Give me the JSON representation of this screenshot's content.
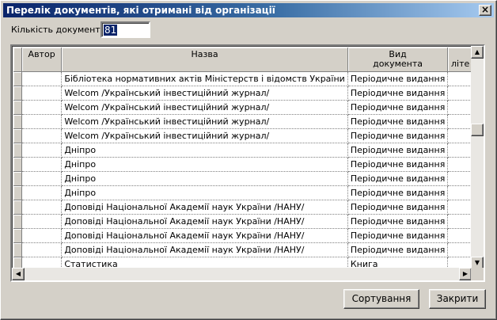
{
  "window": {
    "title": "Перелік документів, які отримані від організації",
    "close_glyph": "×"
  },
  "count": {
    "label": "Кількість документів:",
    "value": "81"
  },
  "grid": {
    "columns": [
      {
        "key": "indicator",
        "label": ""
      },
      {
        "key": "author",
        "label": "Автор"
      },
      {
        "key": "title",
        "label": "Назва"
      },
      {
        "key": "doc_type",
        "label": "Вид\nдокумента"
      },
      {
        "key": "literature",
        "label": "літе"
      }
    ],
    "rows": [
      {
        "author": "",
        "title": "Бібліотека нормативних актів Міністерств і відомств України",
        "doc_type": "Періодичне видання",
        "literature": ""
      },
      {
        "author": "",
        "title": "Welcom /Український інвестиційний журнал/",
        "doc_type": "Періодичне видання",
        "literature": ""
      },
      {
        "author": "",
        "title": "Welcom /Український інвестиційний журнал/",
        "doc_type": "Періодичне видання",
        "literature": ""
      },
      {
        "author": "",
        "title": "Welcom /Український інвестиційний журнал/",
        "doc_type": "Періодичне видання",
        "literature": ""
      },
      {
        "author": "",
        "title": "Welcom /Український інвестиційний журнал/",
        "doc_type": "Періодичне видання",
        "literature": ""
      },
      {
        "author": "",
        "title": "Дніпро",
        "doc_type": "Періодичне видання",
        "literature": ""
      },
      {
        "author": "",
        "title": "Дніпро",
        "doc_type": "Періодичне видання",
        "literature": ""
      },
      {
        "author": "",
        "title": "Дніпро",
        "doc_type": "Періодичне видання",
        "literature": ""
      },
      {
        "author": "",
        "title": "Дніпро",
        "doc_type": "Періодичне видання",
        "literature": ""
      },
      {
        "author": "",
        "title": "Доповіді Національної Академії наук України /НАНУ/",
        "doc_type": "Періодичне видання",
        "literature": ""
      },
      {
        "author": "",
        "title": "Доповіді Національної Академії наук України /НАНУ/",
        "doc_type": "Періодичне видання",
        "literature": ""
      },
      {
        "author": "",
        "title": "Доповіді Національної Академії наук України /НАНУ/",
        "doc_type": "Періодичне видання",
        "literature": ""
      },
      {
        "author": "",
        "title": "Доповіді Національної Академії наук України /НАНУ/",
        "doc_type": "Періодичне видання",
        "literature": ""
      },
      {
        "author": "",
        "title": "Статистика",
        "doc_type": "Книга",
        "literature": ""
      }
    ]
  },
  "buttons": {
    "sort_label": "Сортування",
    "close_label": "Закрити"
  }
}
